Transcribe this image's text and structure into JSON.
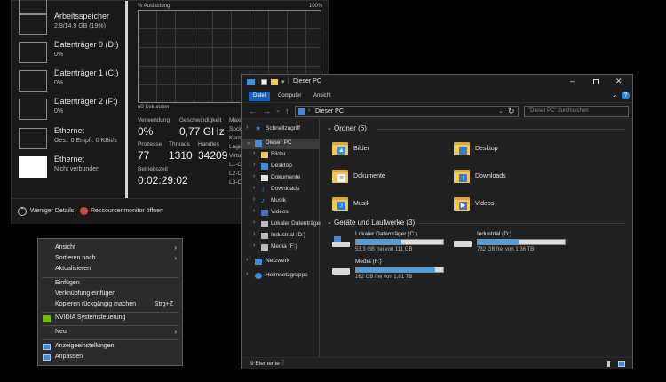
{
  "task_manager": {
    "items": [
      {
        "title": "",
        "sub": ""
      },
      {
        "title": "Arbeitsspeicher",
        "sub": "2,9/14,9 GB (19%)"
      },
      {
        "title": "Datenträger 0 (D:)",
        "sub": "0%"
      },
      {
        "title": "Datenträger 1 (C:)",
        "sub": "0%"
      },
      {
        "title": "Datenträger 2 (F:)",
        "sub": "0%"
      },
      {
        "title": "Ethernet",
        "sub": "Ges.: 0 Empf.: 0 KBit/s"
      },
      {
        "title": "Ethernet",
        "sub": "Nicht verbunden"
      }
    ],
    "graph_label": "% Auslastung",
    "graph_max": "100%",
    "graph_time": "60 Sekunden",
    "stats": {
      "verwendung_label": "Verwendung",
      "verwendung": "0%",
      "geschw_label": "Geschwindigkeit",
      "geschw": "0,77 GHz",
      "prozesse_label": "Prozesse",
      "prozesse": "77",
      "threads_label": "Threads",
      "threads": "1310",
      "handles_label": "Handles",
      "handles": "34209",
      "betriebszeit_label": "Betriebszeit",
      "betriebszeit": "0:02:29:02"
    },
    "right_labels": [
      "Maximale",
      "Sockets:",
      "Kerne:",
      "Logische",
      "Virtualisie",
      "L1-Cache",
      "L2-Cache",
      "L3-Cache"
    ],
    "footer": {
      "less_details": "Weniger Details",
      "resource_monitor": "Ressourcenmonitor öffnen"
    }
  },
  "context_menu": {
    "items": [
      {
        "label": "Ansicht",
        "arrow": true
      },
      {
        "label": "Sortieren nach",
        "arrow": true
      },
      {
        "label": "Aktualisieren"
      },
      {
        "label": "Einfügen"
      },
      {
        "label": "Verknüpfung einfügen"
      },
      {
        "label": "Kopieren rückgängig machen",
        "shortcut": "Strg+Z"
      },
      {
        "label": "NVIDIA Systemsteuerung"
      },
      {
        "label": "Neu",
        "arrow": true
      },
      {
        "label": "Anzeigeeinstellungen"
      },
      {
        "label": "Anpassen"
      }
    ]
  },
  "explorer": {
    "title": "Dieser PC",
    "ribbon_tabs": [
      "Datei",
      "Computer",
      "Ansicht"
    ],
    "address": "Dieser PC",
    "search_placeholder": "\"Dieser PC\" durchsuchen",
    "nav": {
      "quick_access": "Schnellzugriff",
      "this_pc": "Dieser PC",
      "children": [
        "Bilder",
        "Desktop",
        "Dokumente",
        "Downloads",
        "Musik",
        "Videos",
        "Lokaler Datenträger",
        "Industrial (D:)",
        "Media (F:)"
      ],
      "network": "Netzwerk",
      "homegroup": "Heimnetzgruppe"
    },
    "folders_header": "Ordner (6)",
    "folders": [
      "Bilder",
      "Desktop",
      "Dokumente",
      "Downloads",
      "Musik",
      "Videos"
    ],
    "drives_header": "Geräte und Laufwerke (3)",
    "drives": [
      {
        "name": "Lokaler Datenträger (C:)",
        "free": "53,3 GB frei von 111 GB",
        "used_fraction": 0.52
      },
      {
        "name": "Industrial (D:)",
        "free": "732 GB frei von 1,36 TB",
        "used_fraction": 0.47
      },
      {
        "name": "Media (F:)",
        "free": "162 GB frei von 1,81 TB",
        "used_fraction": 0.91
      }
    ],
    "status": "9 Elemente",
    "colors": {
      "accent": "#4aa0e0",
      "folder": "#f2c75c",
      "selection": "#3a3a3a"
    }
  }
}
